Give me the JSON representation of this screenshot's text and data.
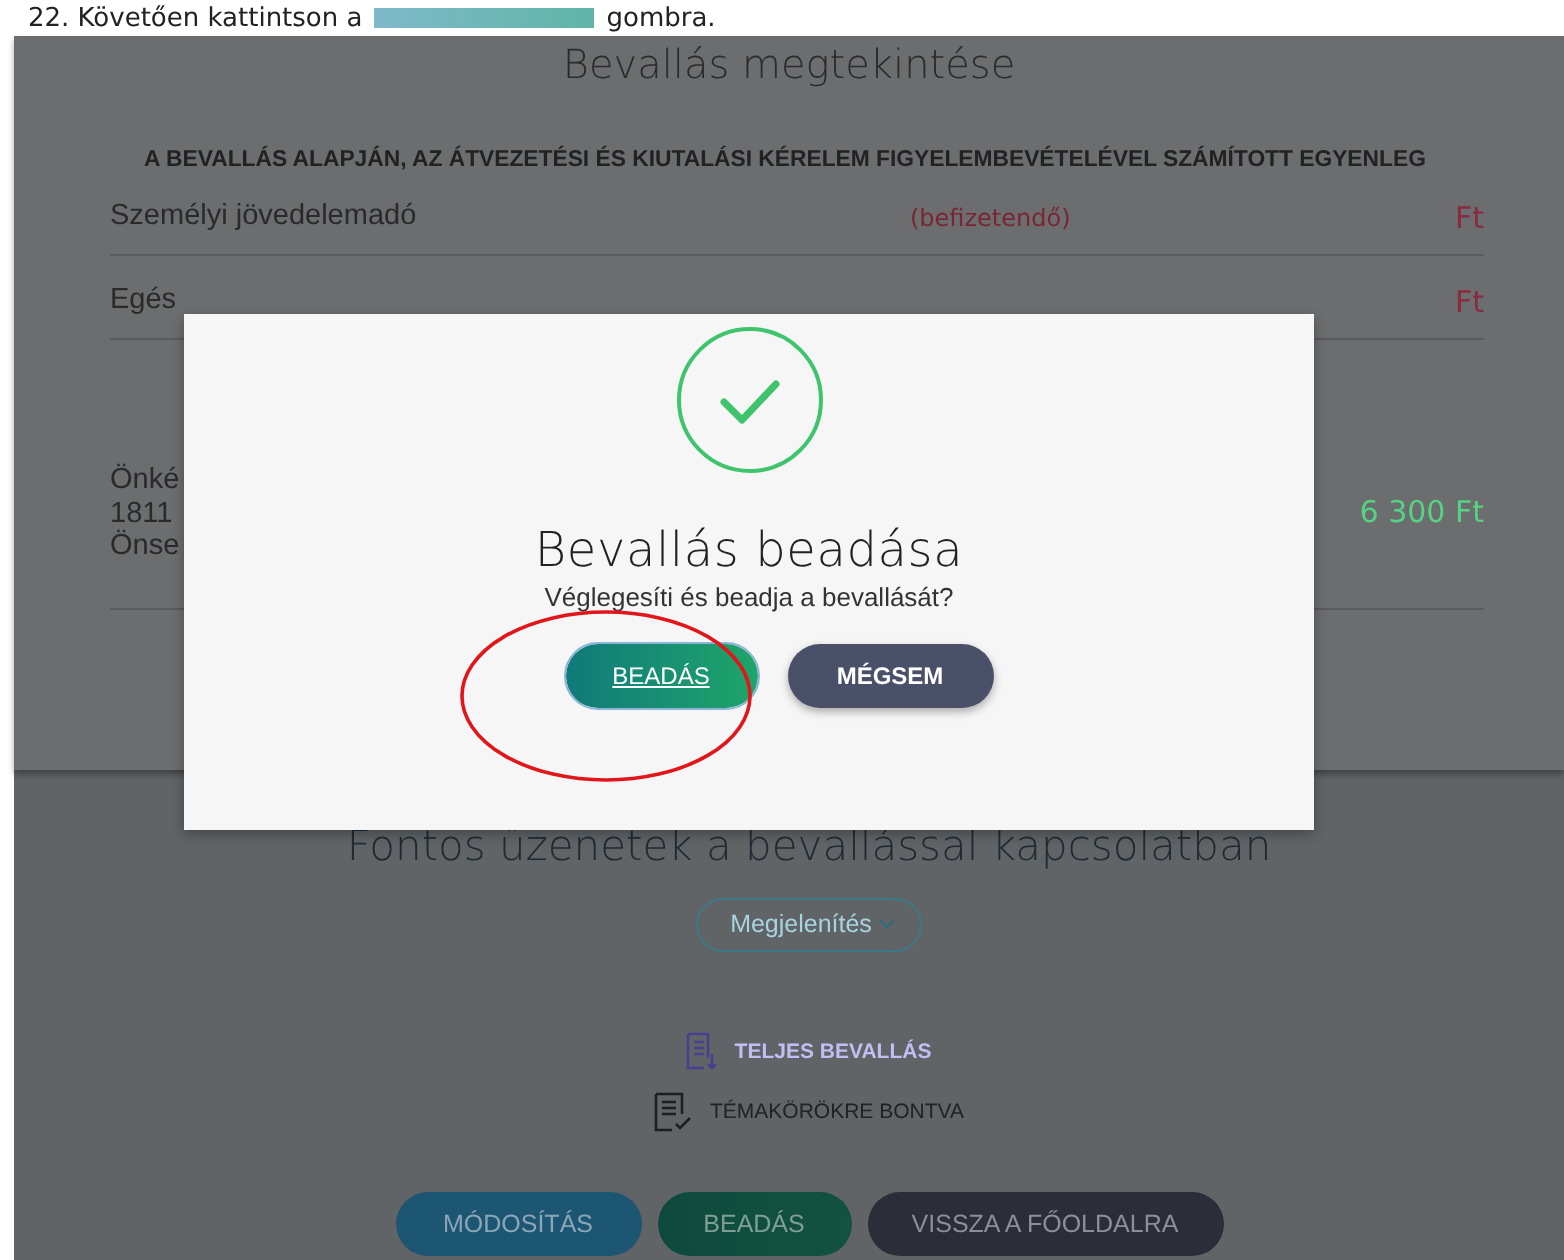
{
  "caption": {
    "before": "22. Követően kattintson a",
    "after": "gombra."
  },
  "page": {
    "title": "Bevallás megtekintése",
    "balance_heading": "A BEVALLÁS ALAPJÁN, AZ ÁTVEZETÉSI ÉS KIUTALÁSI KÉRELEM FIGYELEMBEVÉTELÉVEL SZÁMÍTOTT EGYENLEG",
    "rows": [
      {
        "lines": [
          "Személyi jövedelemadó"
        ],
        "note": "(befizetendő)",
        "amount": "Ft",
        "color": "#8a2a40"
      },
      {
        "lines": [
          "Egés"
        ],
        "amount": "Ft",
        "color": "#8a2a40"
      },
      {
        "lines": [
          "Önké",
          "1811",
          "Önse"
        ],
        "amount": "6 300 Ft",
        "color": "#55d283"
      }
    ]
  },
  "dialog": {
    "title": "Bevallás beadása",
    "message": "Véglegesíti és beadja a bevallását?",
    "buttons": [
      {
        "label": "BEADÁS",
        "kind": "confirm",
        "focused": true
      },
      {
        "label": "MÉGSEM",
        "kind": "cancel",
        "focused": false
      }
    ]
  },
  "annotation": {
    "kind": "ellipse"
  },
  "messages": {
    "title": "Fontos üzenetek a bevallással kapcsolatban",
    "dropdown": "Megjelenítés",
    "links": [
      {
        "label": "TELJES BEVALLÁS",
        "kind": "primary"
      },
      {
        "label": "TÉMAKÖRÖKRE BONTVA",
        "kind": "plain"
      }
    ]
  },
  "actions": [
    {
      "label": "MÓDOSÍTÁS",
      "kind": "modify"
    },
    {
      "label": "BEADÁS",
      "kind": "submit"
    },
    {
      "label": "VISSZA A FŐOLDALRA",
      "kind": "back"
    }
  ]
}
